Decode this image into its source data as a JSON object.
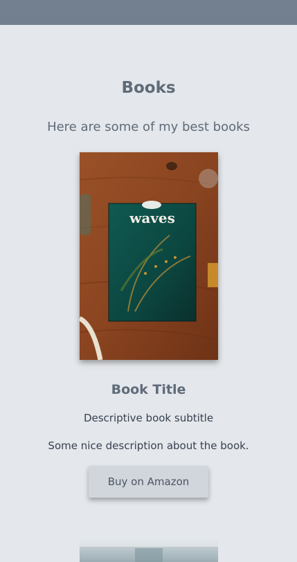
{
  "page": {
    "heading": "Books",
    "intro": "Here are some of my best books"
  },
  "books": [
    {
      "cover_word": "waves",
      "title": "Book Title",
      "subtitle": "Descriptive book subtitle",
      "description": "Some nice description about the book.",
      "buy_label": "Buy on Amazon"
    }
  ],
  "colors": {
    "topbar": "#738090",
    "background": "#e4e7eb",
    "button": "#d1d5dc"
  }
}
